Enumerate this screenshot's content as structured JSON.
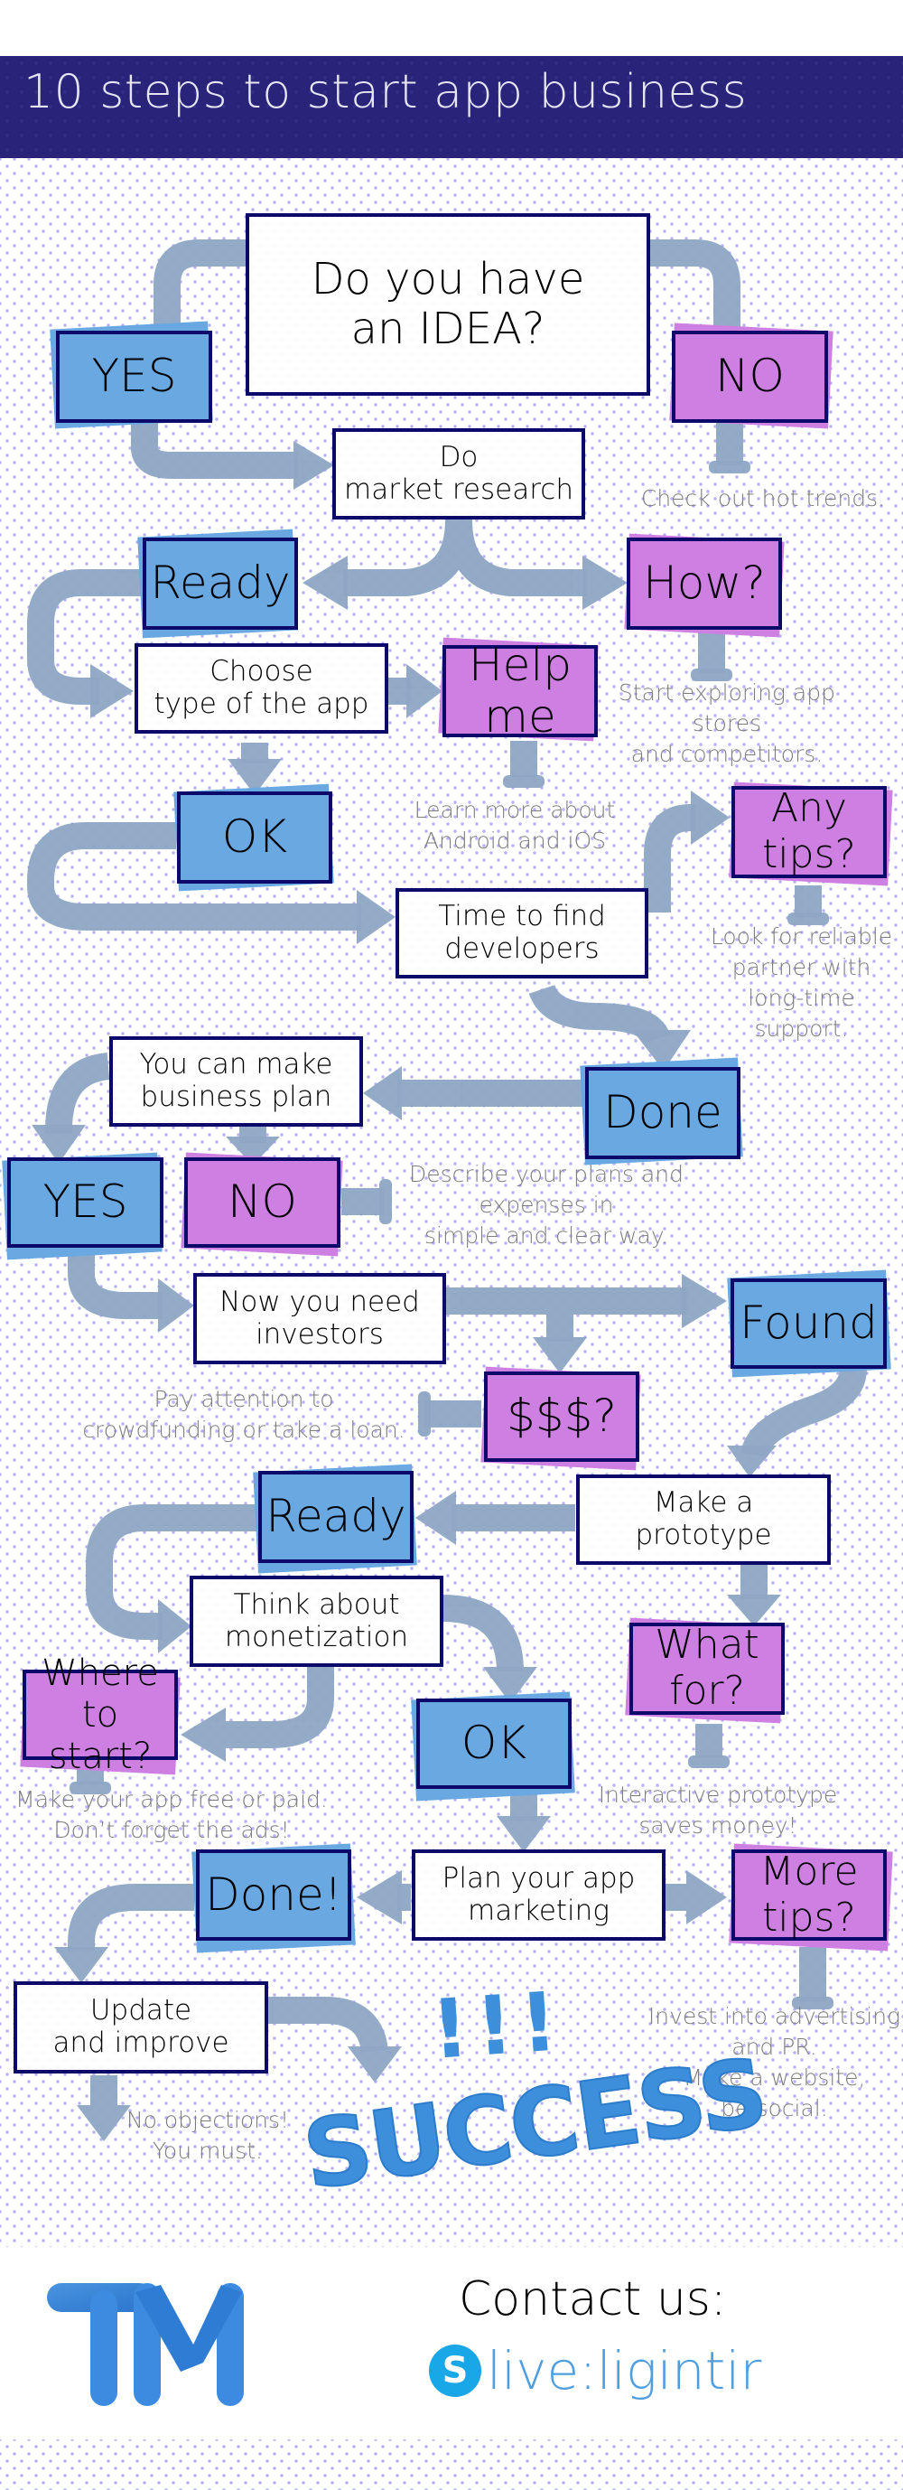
{
  "header": {
    "title": "10 steps to start app business"
  },
  "colors": {
    "header_bg": "#29237a",
    "yes_box": "#6aa8e2",
    "question_box": "#cd7fe2",
    "pipe": "#8ea6c4",
    "box_border": "#0b0a6b",
    "note_text": "#7d7d7d",
    "success": "#3d8fdc"
  },
  "flow": {
    "idea": [
      "Do you have",
      "an IDEA?"
    ],
    "yes1": "YES",
    "no1": "NO",
    "market_research": [
      "Do",
      "market research"
    ],
    "note_hot_trends": "Check out hot trends.",
    "ready1": "Ready",
    "how": "How?",
    "choose_type": [
      "Choose",
      "type of the app"
    ],
    "help_me": [
      "Help",
      "me"
    ],
    "note_explore": [
      "Start exploring app",
      "stores",
      "and competitors."
    ],
    "note_learn": [
      "Learn more about",
      "Android and iOS"
    ],
    "ok1": "OK",
    "any_tips": [
      "Any",
      "tips?"
    ],
    "find_developers": [
      "Time to find",
      "developers"
    ],
    "note_partner": [
      "Look for reliable",
      "partner with",
      "long-time",
      "support."
    ],
    "done1": "Done",
    "business_plan": [
      "You can make",
      "business plan"
    ],
    "yes2": "YES",
    "no2": "NO",
    "note_describe": [
      "Describe your plans and",
      "expenses in",
      "simple and clear way."
    ],
    "investors": [
      "Now you need",
      "investors"
    ],
    "found": "Found",
    "money": "$$$?",
    "note_crowdfunding": [
      "Pay attention to",
      "crowdfunding or take a loan."
    ],
    "ready2": "Ready",
    "prototype": [
      "Make a",
      "prototype"
    ],
    "monetization": [
      "Think about",
      "monetization"
    ],
    "what_for": [
      "What",
      "for?"
    ],
    "where_start": [
      "Where",
      "to start?"
    ],
    "ok2": "OK",
    "note_free_paid": [
      "Make your app free or paid.",
      "Don’t forget the ads!"
    ],
    "note_interactive": [
      "Interactive prototype",
      "saves money!"
    ],
    "done2": "Done!",
    "marketing": [
      "Plan your app",
      "marketing"
    ],
    "more_tips": [
      "More",
      "tips?"
    ],
    "update": [
      "Update",
      "and improve"
    ],
    "bangs": "!!!",
    "success": "SUCCESS",
    "note_objections": [
      "No objections!",
      "You must."
    ],
    "note_advertising": [
      "Invest into advertising",
      "and PR.",
      "Make a website,",
      "be social."
    ]
  },
  "footer": {
    "logo_text": "TM",
    "contact_label": "Contact us:",
    "skype_icon": "skype-icon",
    "skype_letter": "S",
    "skype_id": "live:ligintir"
  }
}
